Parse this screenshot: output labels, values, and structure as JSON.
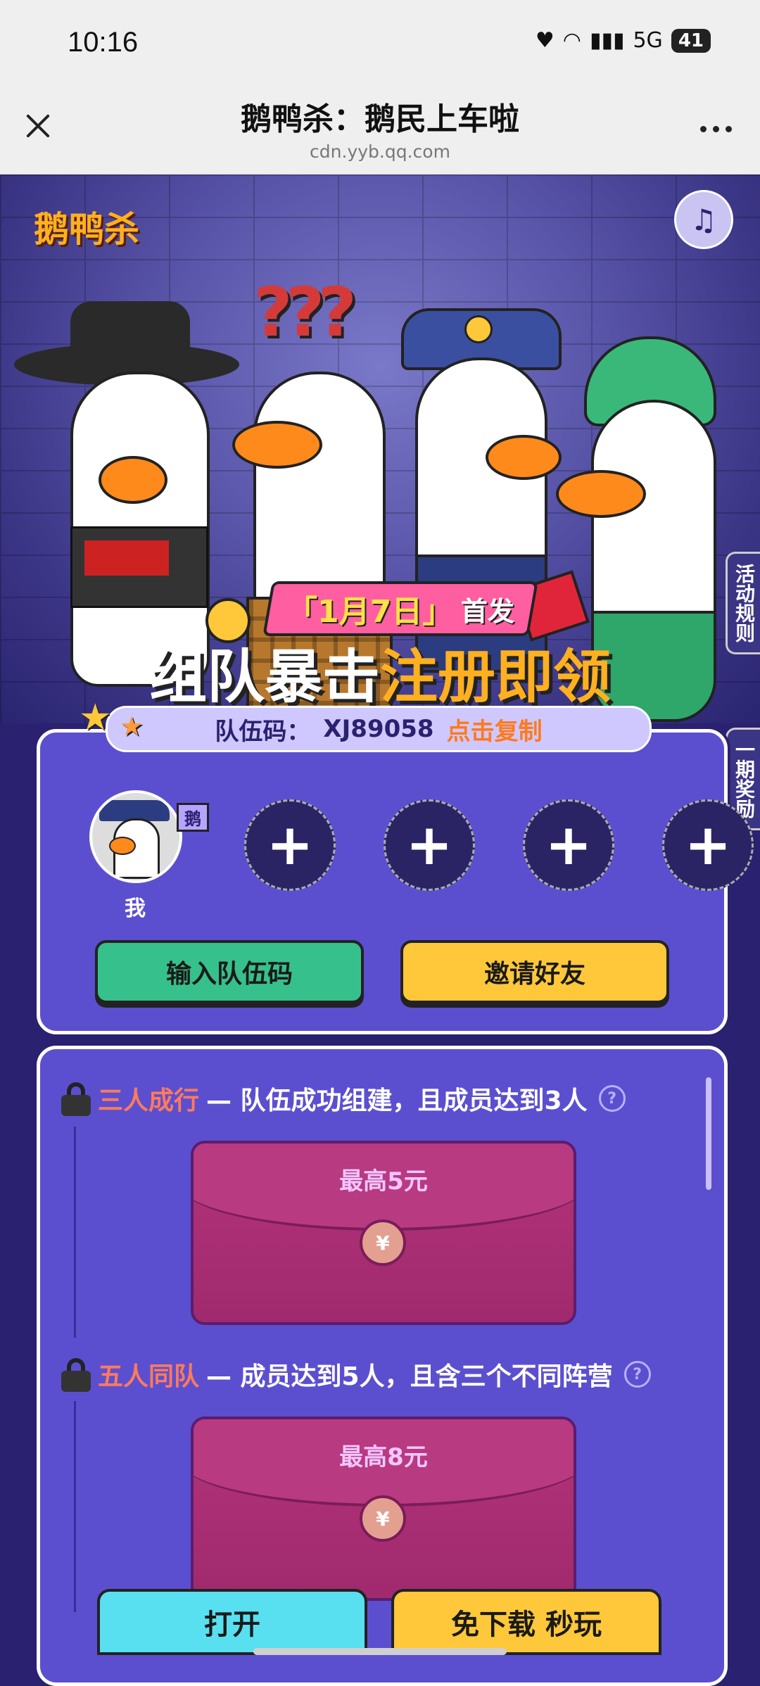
{
  "status_bar": {
    "time": "10:16",
    "network": "5G",
    "battery": "41"
  },
  "browser": {
    "title": "鹅鸭杀：鹅民上车啦",
    "url": "cdn.yyb.qq.com"
  },
  "hero": {
    "logo_text": "鹅鸭杀"
  },
  "side_tabs": {
    "rules": "活动规则",
    "rewards": "一期奖励"
  },
  "promo": {
    "date": "「1月7日」",
    "date_suffix": "首发",
    "headline_a": "组队暴击",
    "headline_b": "注册即领",
    "team_code_label": "队伍码：",
    "team_code": "XJ89058",
    "copy_label": "点击复制"
  },
  "team": {
    "me_tag": "鹅",
    "me_label": "我",
    "slot_symbol": "+",
    "enter_code_btn": "输入队伍码",
    "invite_btn": "邀请好友"
  },
  "rewards": [
    {
      "name": "三人成行",
      "desc": "— 队伍成功组建，且成员达到3人",
      "amount": "最高5元"
    },
    {
      "name": "五人同队",
      "desc": "— 成员达到5人，且含三个不同阵营",
      "amount": "最高8元"
    }
  ],
  "bottom": {
    "open_btn": "打开",
    "play_btn": "免下载 秒玩"
  }
}
